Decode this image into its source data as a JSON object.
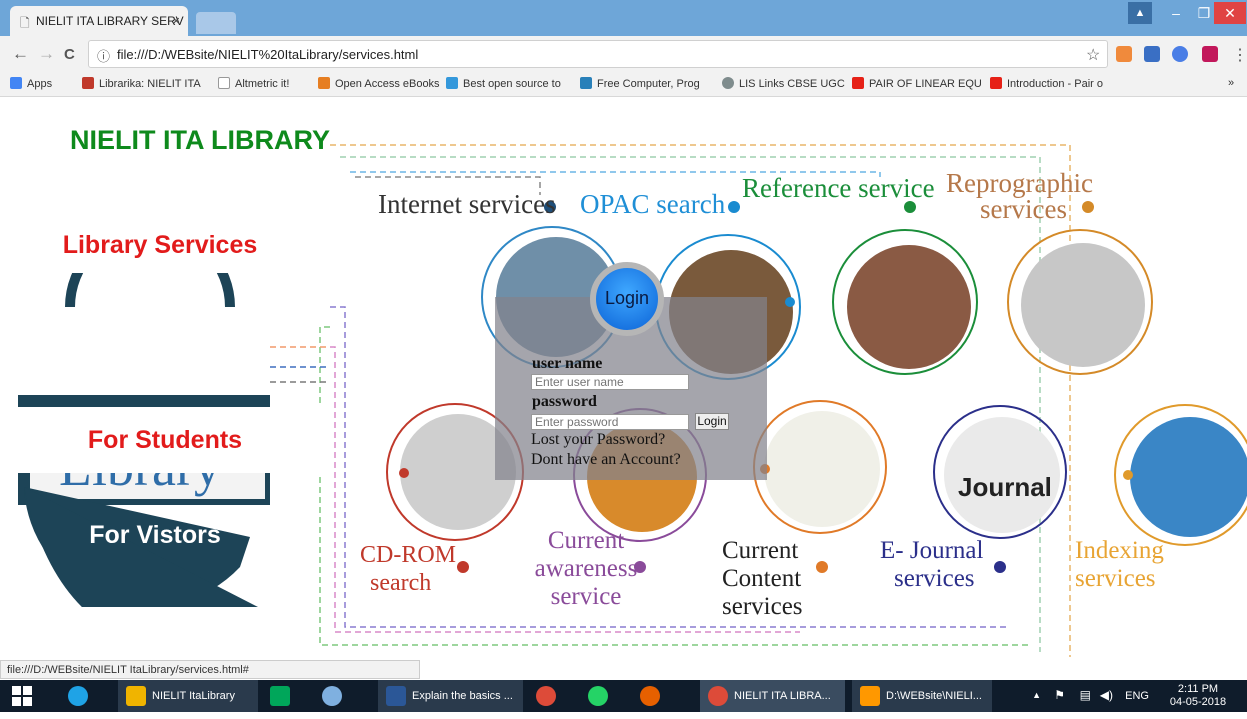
{
  "browser": {
    "tab_title": "NIELIT ITA LIBRARY SERV",
    "tab_close": "×",
    "address": "file:///D:/WEBsite/NIELIT%20ItaLibrary/services.html",
    "window_controls": {
      "minimize": "–",
      "maximize": "❐",
      "close": "✕",
      "user": "▲"
    },
    "nav": {
      "back": "←",
      "forward": "→",
      "reload": "C",
      "info": "ⓘ",
      "star": "☆",
      "menu": "⋮"
    },
    "bookmarks": [
      {
        "label": "Apps",
        "color": "#4285f4"
      },
      {
        "label": "Librarika: NIELIT ITA",
        "color": "#c0392b"
      },
      {
        "label": "Altmetric it!",
        "color": "#999999"
      },
      {
        "label": "Open Access eBooks",
        "color": "#e67e22"
      },
      {
        "label": "Best open source to",
        "color": "#3498db"
      },
      {
        "label": "Free Computer, Prog",
        "color": "#2980b9"
      },
      {
        "label": "LIS Links CBSE UGC",
        "color": "#7f8c8d"
      },
      {
        "label": "PAIR OF LINEAR EQU",
        "color": "#e62117"
      },
      {
        "label": "Introduction - Pair o",
        "color": "#e62117"
      }
    ],
    "bookmarks_more": "»",
    "status_url": "file:///D:/WEBsite/NIELIT ItaLibrary/services.html#"
  },
  "page": {
    "site_title": "NIELIT ITA LIBRARY",
    "menu": {
      "library_services": "Library Services",
      "for_students": "For Students",
      "for_visitors": "For Vistors"
    },
    "services": {
      "internet": "Internet services",
      "opac": "OPAC search",
      "reference": "Reference service",
      "reprographic_1": "Reprographic",
      "reprographic_2": "services",
      "cdrom_1": "CD-ROM",
      "cdrom_2": "search",
      "current_awareness_1": "Current",
      "current_awareness_2": "awareness",
      "current_awareness_3": "service",
      "current_content_1": "Current",
      "current_content_2": "Content",
      "current_content_3": "services",
      "ejournal_1": "E- Journal",
      "ejournal_2": "services",
      "indexing_1": "Indexing",
      "indexing_2": "services",
      "journal_badge": "Journal"
    },
    "login": {
      "button": "Login",
      "username_label": "user name",
      "username_placeholder": "Enter user name",
      "password_label": "password",
      "password_placeholder": "Enter password",
      "submit": "Login",
      "lost_password": "Lost your Password?",
      "no_account": "Dont have an Account?"
    }
  },
  "taskbar": {
    "items": [
      {
        "label": "NIELIT ItaLibrary",
        "color": "#f0b400"
      },
      {
        "label": "Explain the basics ...",
        "color": "#2b5797"
      },
      {
        "label": "NIELIT ITA LIBRA...",
        "color": "#dd4b39"
      },
      {
        "label": "D:\\WEBsite\\NIELI...",
        "color": "#ff9800"
      }
    ],
    "lang": "ENG",
    "time": "2:11 PM",
    "date": "04-05-2018"
  }
}
